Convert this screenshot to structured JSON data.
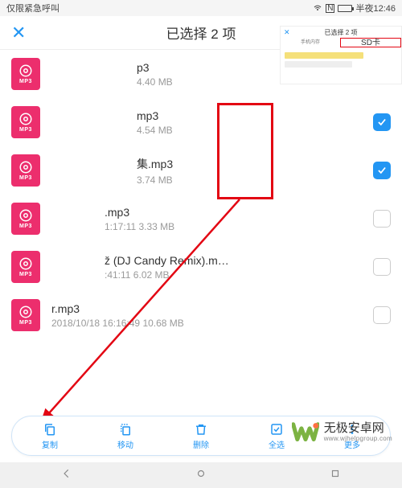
{
  "status": {
    "left": "仅限紧急呼叫",
    "time": "半夜12:46"
  },
  "header": {
    "title": "已选择 2 项"
  },
  "mp3_label": "MP3",
  "files": [
    {
      "name": "p3",
      "meta": "4.40 MB",
      "checked": false,
      "shift": 2
    },
    {
      "name": "mp3",
      "meta": "4.54 MB",
      "checked": true,
      "shift": 2
    },
    {
      "name": "集.mp3",
      "meta": "   3.74 MB",
      "checked": true,
      "shift": 2
    },
    {
      "name": ".mp3",
      "meta": "1:17:11 3.33 MB",
      "checked": false,
      "shift": 1
    },
    {
      "name": "ž (DJ Candy Remix).m…",
      "meta": ":41:11 6.02 MB",
      "checked": false,
      "shift": 1
    },
    {
      "name": "r.mp3",
      "meta": "2018/10/18 16:16:49 10.68 MB",
      "checked": false,
      "shift": 0
    }
  ],
  "actions": {
    "copy": "复制",
    "move": "移动",
    "delete": "删除",
    "select_all": "全选",
    "more": "更多"
  },
  "thumb": {
    "title": "已选择 2 项",
    "tab1": "手机内存",
    "tab2": "SD卡"
  },
  "watermark": {
    "cn": "无极安卓网",
    "en": "www.wjhelpgroup.com"
  }
}
